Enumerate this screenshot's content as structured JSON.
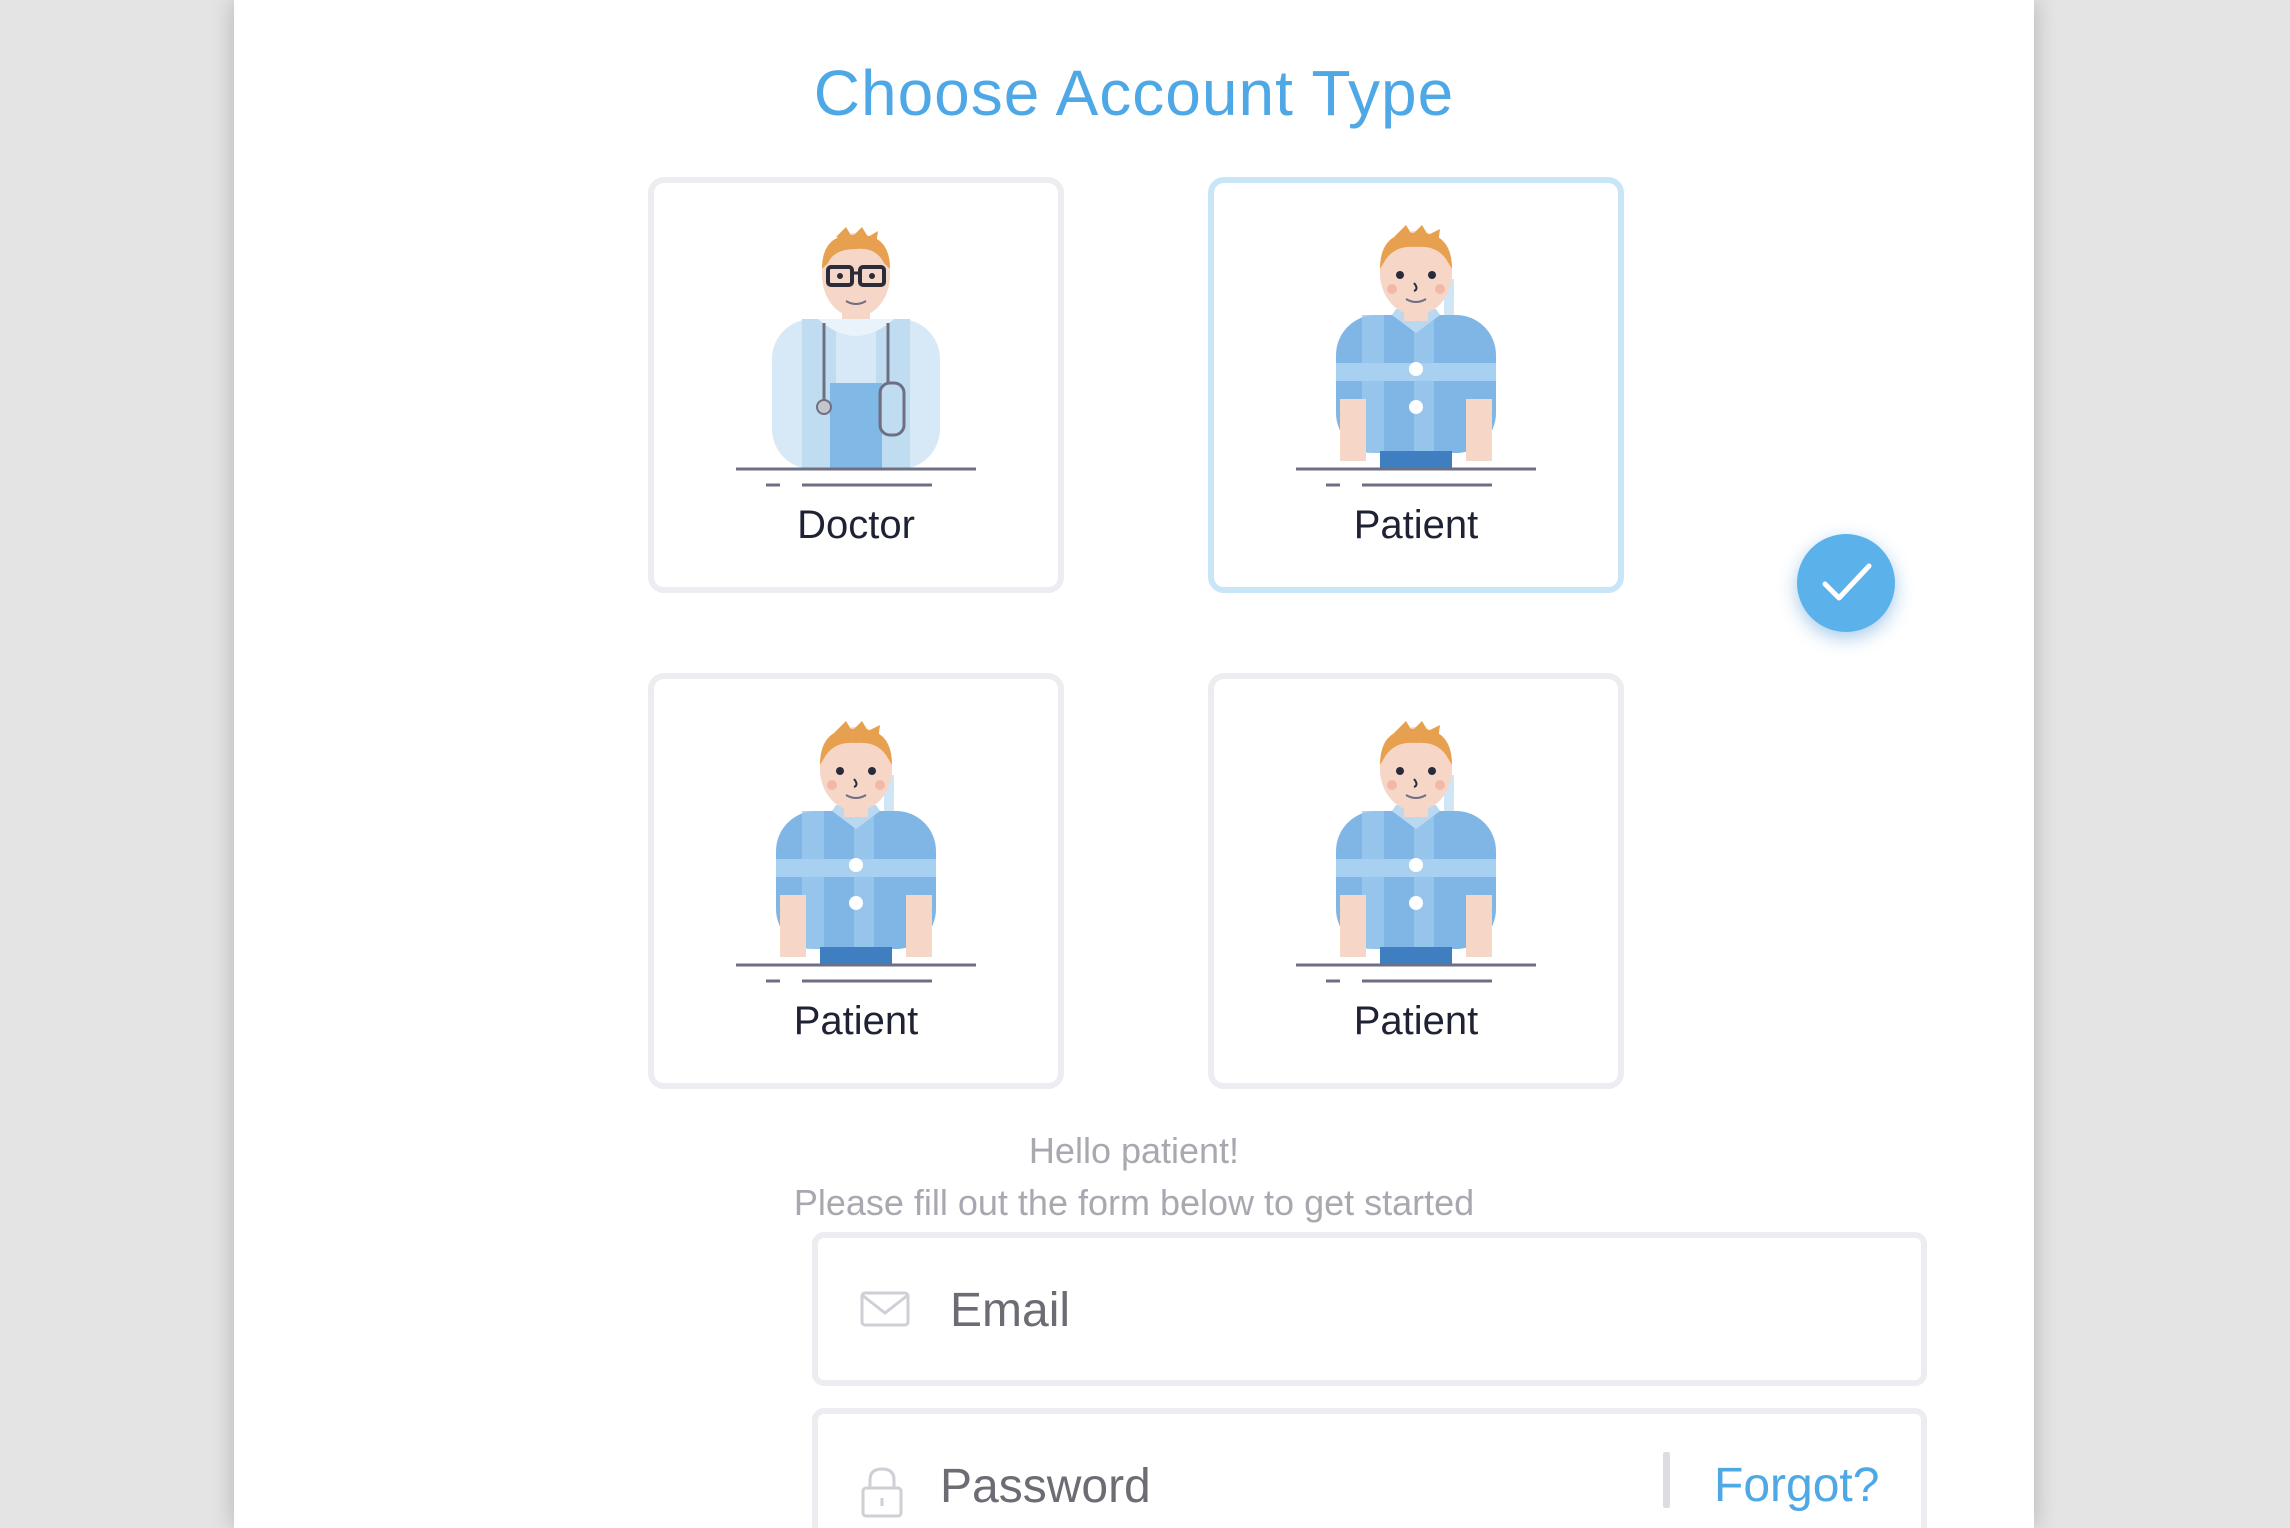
{
  "header": {
    "title": "Choose Account Type"
  },
  "account_types": [
    {
      "label": "Doctor",
      "selected": false,
      "illustration": "doctor-illustration"
    },
    {
      "label": "Patient",
      "selected": true,
      "illustration": "patient-illustration"
    },
    {
      "label": "Patient",
      "selected": false,
      "illustration": "patient-illustration"
    },
    {
      "label": "Patient",
      "selected": false,
      "illustration": "patient-illustration"
    }
  ],
  "selected_indicator": {
    "icon": "checkmark-icon",
    "color": "#5bb2ea"
  },
  "message": {
    "greeting": "Hello patient!",
    "instruction": "Please fill out the form below to get started"
  },
  "form": {
    "email": {
      "placeholder": "Email",
      "value": "",
      "icon": "mail-icon"
    },
    "password": {
      "placeholder": "Password",
      "value": "",
      "icon": "lock-icon"
    },
    "forgot_label": "Forgot?"
  },
  "colors": {
    "accent": "#4ea8e6",
    "tile_border": "#ececf1",
    "selected_border": "#c9e6f8",
    "page_background": "#e4e4e4"
  }
}
